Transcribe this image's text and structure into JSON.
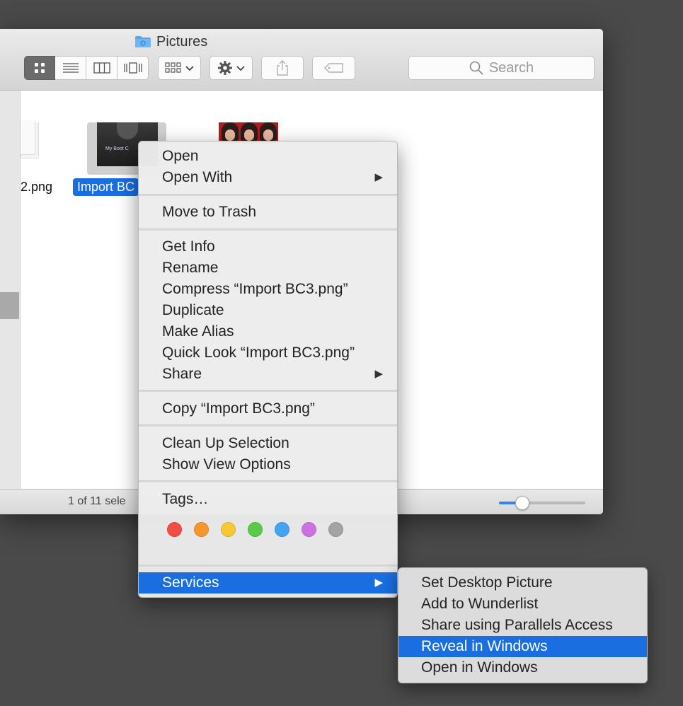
{
  "window": {
    "title": "Pictures",
    "search_placeholder": "Search",
    "status_text": "1 of 11 sele",
    "icon_size_fraction": 0.26
  },
  "toolbar": {
    "view_buttons": [
      {
        "icon": "icon-view-icon",
        "active": true
      },
      {
        "icon": "list-view-icon",
        "active": false
      },
      {
        "icon": "column-view-icon",
        "active": false
      },
      {
        "icon": "cover-flow-icon",
        "active": false
      }
    ],
    "arrange_icon": "arrange-grid-icon",
    "action_icon": "gear-icon",
    "share_icon": "share-icon",
    "tag_icon": "tag-icon"
  },
  "files": [
    {
      "label": "2.png"
    },
    {
      "label": "Import BC",
      "selected": true,
      "thumb_text": "My Boot C"
    },
    {
      "label": ""
    }
  ],
  "context_menu": {
    "items": [
      {
        "label": "Open"
      },
      {
        "label": "Open With",
        "submenu": true
      },
      {
        "label": "Move to Trash"
      },
      {
        "label": "Get Info"
      },
      {
        "label": "Rename"
      },
      {
        "label": "Compress “Import BC3.png”"
      },
      {
        "label": "Duplicate"
      },
      {
        "label": "Make Alias"
      },
      {
        "label": "Quick Look “Import BC3.png”"
      },
      {
        "label": "Share",
        "submenu": true
      },
      {
        "label": "Copy “Import BC3.png”"
      },
      {
        "label": "Clean Up Selection"
      },
      {
        "label": "Show View Options"
      },
      {
        "label": "Tags…"
      },
      {
        "label": "Services",
        "submenu": true,
        "highlighted": true
      }
    ],
    "submenu_arrow": "▶",
    "tag_colors": [
      "#f24e46",
      "#f7962e",
      "#f6c834",
      "#5bc94a",
      "#45a4f2",
      "#cc72e0",
      "#a3a3a3"
    ]
  },
  "services_menu": {
    "items": [
      {
        "label": "Set Desktop Picture"
      },
      {
        "label": "Add to Wunderlist"
      },
      {
        "label": "Share using Parallels Access"
      },
      {
        "label": "Reveal in Windows",
        "highlighted": true
      },
      {
        "label": "Open in Windows"
      }
    ]
  },
  "colors": {
    "accent": "#1a6ee0",
    "desktop": "#4a4a4a",
    "folder": "#5aa7ec"
  }
}
